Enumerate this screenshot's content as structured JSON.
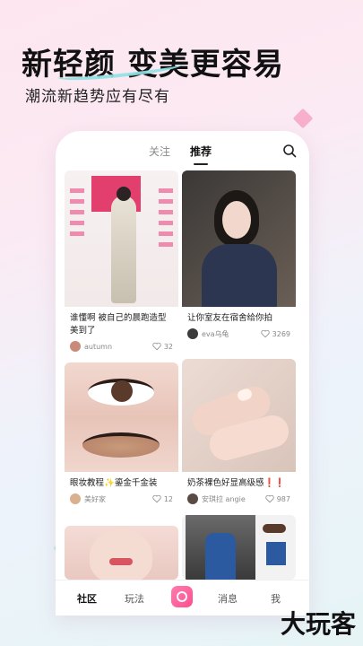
{
  "promo": {
    "headline": "新轻颜 变美更容易",
    "subline": "潮流新趋势应有尽有"
  },
  "tabs": [
    {
      "label": "关注",
      "active": false
    },
    {
      "label": "推荐",
      "active": true
    }
  ],
  "feed": [
    {
      "title": "谁懂啊 被自己的晨跑造型美到了",
      "author": "autumn",
      "likes": "32",
      "avatar_color": "#c98a7a"
    },
    {
      "title": "让你室友在宿舍给你拍",
      "author": "eva乌龟",
      "likes": "3269",
      "avatar_color": "#3b3b3b"
    },
    {
      "title": "眼妆教程✨鎏金千金装",
      "author": "美好家",
      "likes": "12",
      "avatar_color": "#d9b090"
    },
    {
      "title": "奶茶裸色好显高级感❗❗",
      "author": "安琪拉 angie",
      "likes": "987",
      "avatar_color": "#5a4a44"
    },
    {
      "title": "",
      "author": "",
      "likes": "",
      "avatar_color": "#e8c0b8"
    },
    {
      "title": "",
      "author": "",
      "likes": "",
      "avatar_color": "#2b5aa0"
    }
  ],
  "bottom_nav": [
    {
      "label": "社区",
      "active": true
    },
    {
      "label": "玩法",
      "active": false
    },
    {
      "label": "消息",
      "active": false
    },
    {
      "label": "我",
      "active": false
    }
  ],
  "watermark": "大玩客",
  "colors": {
    "accent": "#ff4d8d",
    "teal": "#8fe3e6",
    "pink_sparkle": "#f6a8c8"
  }
}
